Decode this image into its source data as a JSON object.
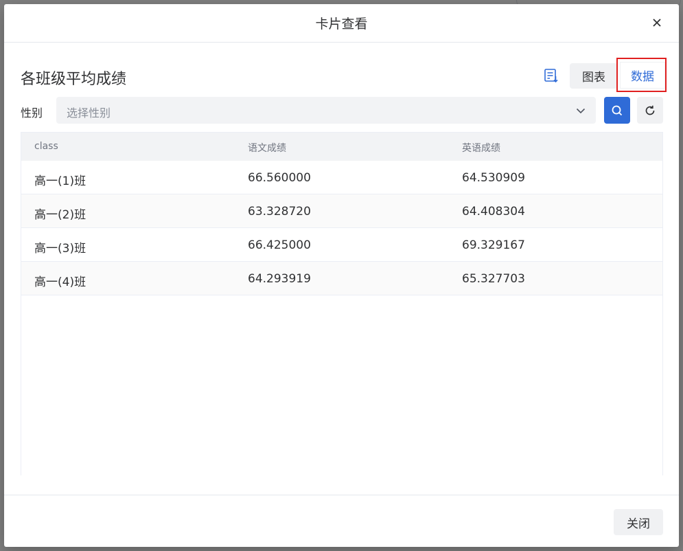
{
  "dialog": {
    "title": "卡片查看",
    "close_icon": "close-icon",
    "footer_close_label": "关闭"
  },
  "card": {
    "title": "各班级平均成绩",
    "export_icon": "list-export-icon",
    "view_toggle": {
      "chart_label": "图表",
      "data_label": "数据",
      "selected": "数据"
    }
  },
  "filter": {
    "label": "性别",
    "placeholder": "选择性别",
    "value": "",
    "search_icon": "search-icon",
    "reset_icon": "refresh-icon"
  },
  "table": {
    "columns": [
      "class",
      "语文成绩",
      "英语成绩"
    ],
    "rows": [
      [
        "高一(1)班",
        "66.560000",
        "64.530909"
      ],
      [
        "高一(2)班",
        "63.328720",
        "64.408304"
      ],
      [
        "高一(3)班",
        "66.425000",
        "69.329167"
      ],
      [
        "高一(4)班",
        "64.293919",
        "65.327703"
      ]
    ]
  },
  "colors": {
    "primary": "#2f6bd7",
    "highlight_box": "#e02020"
  }
}
